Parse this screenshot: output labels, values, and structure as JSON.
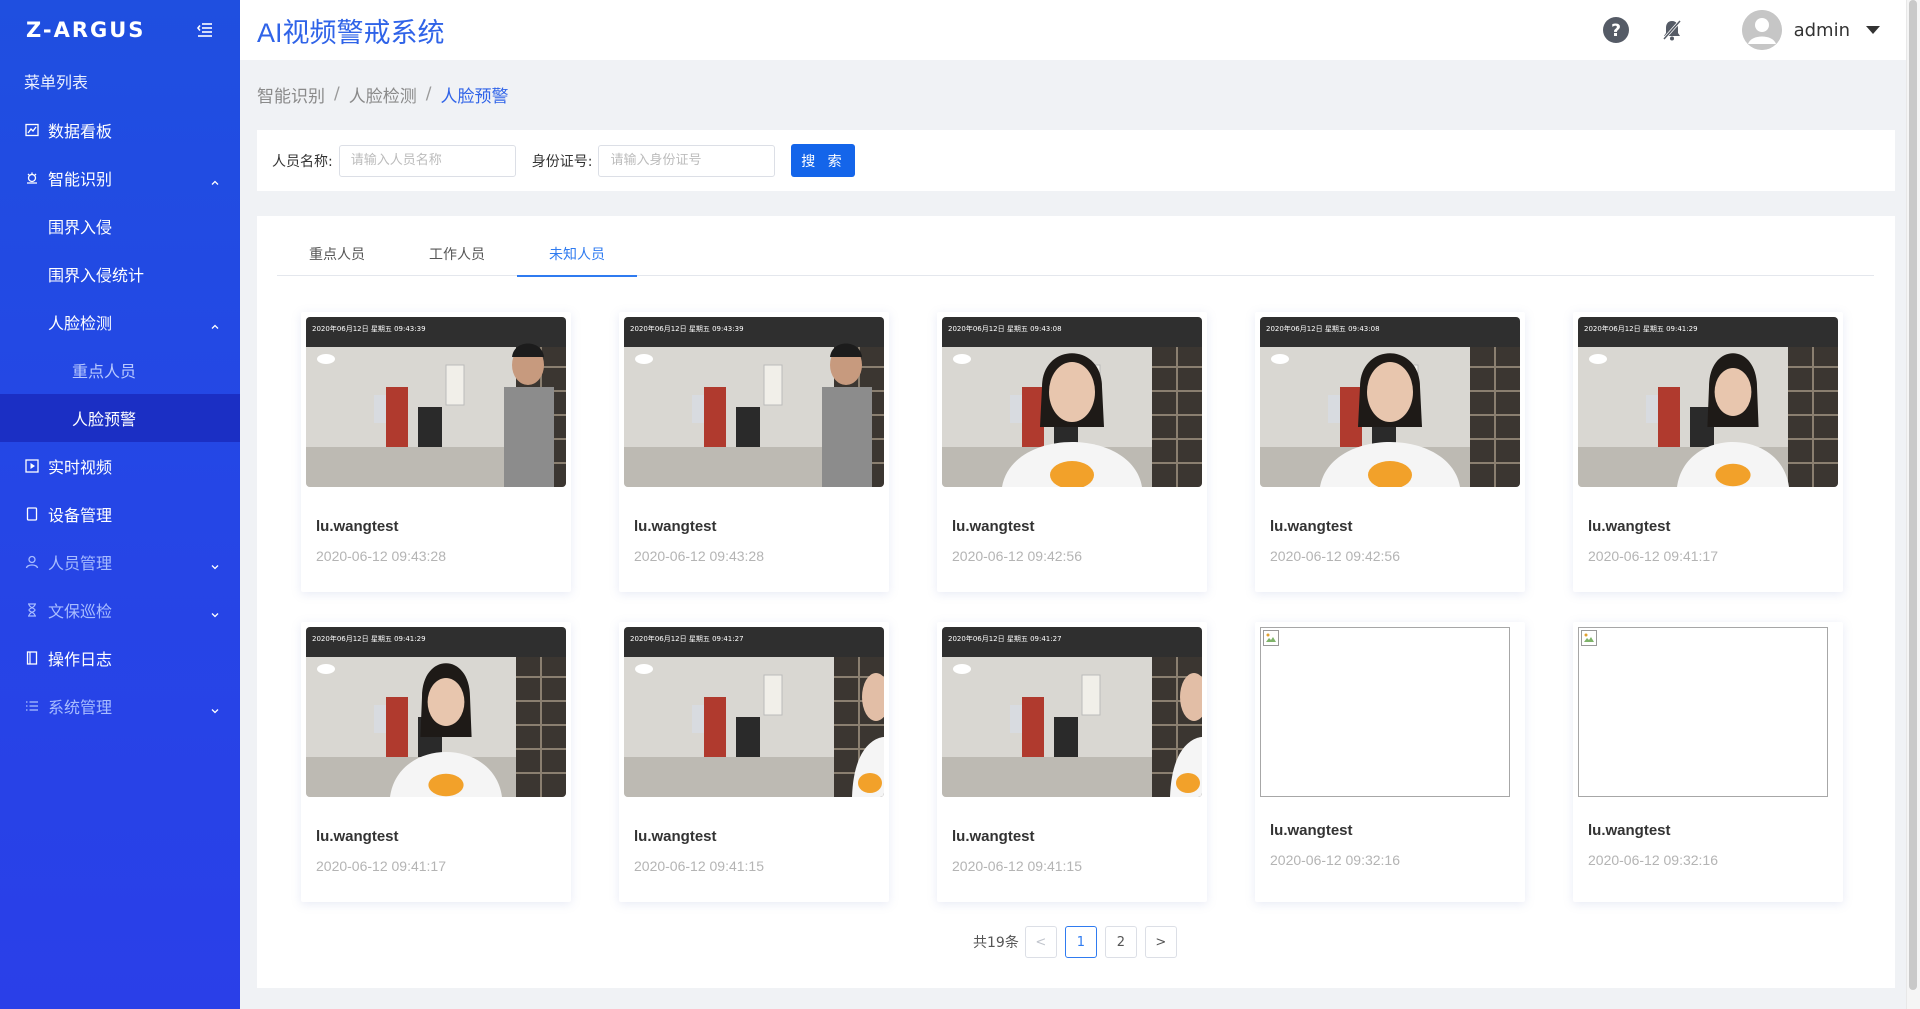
{
  "app": {
    "logo": "Z-ARGUS",
    "title": "AI视频警戒系统"
  },
  "header": {
    "user_name": "admin"
  },
  "sidebar": {
    "menu_title": "菜单列表",
    "items": [
      {
        "label": "数据看板",
        "icon": "dashboard-icon"
      },
      {
        "label": "智能识别",
        "icon": "camera-icon",
        "expanded": true
      },
      {
        "label": "围界入侵"
      },
      {
        "label": "围界入侵统计"
      },
      {
        "label": "人脸检测",
        "expanded": true
      },
      {
        "label": "重点人员"
      },
      {
        "label": "人脸预警",
        "active": true
      },
      {
        "label": "实时视频",
        "icon": "play-icon"
      },
      {
        "label": "设备管理",
        "icon": "device-icon"
      },
      {
        "label": "人员管理",
        "icon": "user-icon",
        "expanded": false
      },
      {
        "label": "文保巡检",
        "icon": "hourglass-icon",
        "expanded": false
      },
      {
        "label": "操作日志",
        "icon": "log-icon"
      },
      {
        "label": "系统管理",
        "icon": "list-icon",
        "expanded": false
      }
    ]
  },
  "breadcrumb": [
    "智能识别",
    "人脸检测",
    "人脸预警"
  ],
  "breadcrumb_sep": "/",
  "search": {
    "name_label": "人员名称:",
    "name_placeholder": "请输入人员名称",
    "id_label": "身份证号:",
    "id_placeholder": "请输入身份证号",
    "button_label": "搜 索"
  },
  "tabs": [
    {
      "label": "重点人员",
      "active": false
    },
    {
      "label": "工作人员",
      "active": false
    },
    {
      "label": "未知人员",
      "active": true
    }
  ],
  "cards": [
    {
      "name": "lu.wangtest",
      "time": "2020-06-12 09:43:28",
      "stamp": "2020年06月12日 星期五 09:43:39",
      "has_image": true,
      "scene": "man"
    },
    {
      "name": "lu.wangtest",
      "time": "2020-06-12 09:43:28",
      "stamp": "2020年06月12日 星期五 09:43:39",
      "has_image": true,
      "scene": "man"
    },
    {
      "name": "lu.wangtest",
      "time": "2020-06-12 09:42:56",
      "stamp": "2020年06月12日 星期五 09:43:08",
      "has_image": true,
      "scene": "woman-center"
    },
    {
      "name": "lu.wangtest",
      "time": "2020-06-12 09:42:56",
      "stamp": "2020年06月12日 星期五 09:43:08",
      "has_image": true,
      "scene": "woman-center"
    },
    {
      "name": "lu.wangtest",
      "time": "2020-06-12 09:41:17",
      "stamp": "2020年06月12日 星期五 09:41:29",
      "has_image": true,
      "scene": "woman-right"
    },
    {
      "name": "lu.wangtest",
      "time": "2020-06-12 09:41:17",
      "stamp": "2020年06月12日 星期五 09:41:29",
      "has_image": true,
      "scene": "woman-left"
    },
    {
      "name": "lu.wangtest",
      "time": "2020-06-12 09:41:15",
      "stamp": "2020年06月12日 星期五 09:41:27",
      "has_image": true,
      "scene": "woman-edge"
    },
    {
      "name": "lu.wangtest",
      "time": "2020-06-12 09:41:15",
      "stamp": "2020年06月12日 星期五 09:41:27",
      "has_image": true,
      "scene": "woman-edge"
    },
    {
      "name": "lu.wangtest",
      "time": "2020-06-12 09:32:16",
      "has_image": false
    },
    {
      "name": "lu.wangtest",
      "time": "2020-06-12 09:32:16",
      "has_image": false
    }
  ],
  "pagination": {
    "total_text": "共19条",
    "pages": [
      "1",
      "2"
    ],
    "current": "1",
    "prev": "<",
    "next": ">"
  },
  "colors": {
    "primary": "#2f63e8",
    "sidebar": "#2546e6",
    "sidebar_active": "#1b2fc4",
    "search_button": "#1465ea"
  }
}
